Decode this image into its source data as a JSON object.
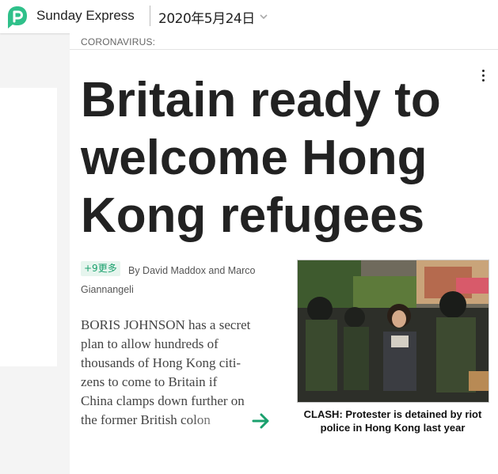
{
  "header": {
    "publication": "Sunday Express",
    "date": "2020年5月24日",
    "logo_icon": "p-speech-bubble-logo-icon",
    "date_chevron_icon": "chevron-down-icon"
  },
  "article": {
    "section": "CORONAVIRUS:",
    "headline": "Britain ready to welcome Hong Kong refugees",
    "more_badge": "+9更多",
    "byline": "By David Maddox and Marco Giannangeli",
    "body_lines": [
      "BORIS JOHNSON has a secret",
      "plan to allow hundreds of",
      "thousands of Hong Kong citi-",
      "zens to come to Britain if",
      "China clamps down further on",
      "the former British colon"
    ],
    "continue_icon": "arrow-right-icon",
    "menu_icon": "kebab-menu-icon",
    "image_caption": "CLASH: Protester is detained by riot police in Hong Kong last year"
  },
  "colors": {
    "accent": "#1aa06d",
    "background": "#f4f4f4"
  }
}
